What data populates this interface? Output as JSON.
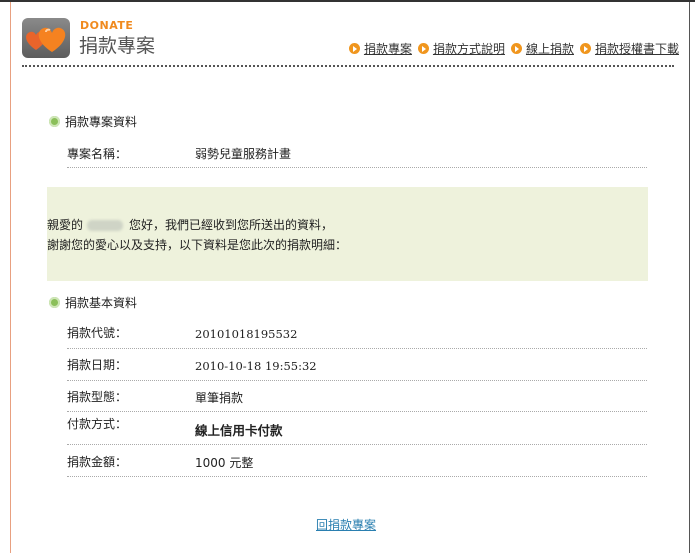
{
  "brand": {
    "en": "DONATE",
    "zh": "捐款專案"
  },
  "nav": [
    {
      "label": "捐款專案"
    },
    {
      "label": "捐款方式說明"
    },
    {
      "label": "線上捐款"
    },
    {
      "label": "捐款授權書下載"
    }
  ],
  "project_section": {
    "title": "捐款專案資料",
    "rows": [
      {
        "label": "專案名稱：",
        "value": "弱勢兒童服務計畫"
      }
    ]
  },
  "notice": {
    "prefix": "親愛的",
    "suffix": "您好，我們已經收到您所送出的資料，",
    "line2": "謝謝您的愛心以及支持，以下資料是您此次的捐款明細："
  },
  "basic_section": {
    "title": "捐款基本資料",
    "rows": [
      {
        "label": "捐款代號：",
        "value": "20101018195532"
      },
      {
        "label": "捐款日期：",
        "value": "2010-10-18 19:55:32"
      },
      {
        "label": "捐款型態：",
        "value": "單筆捐款"
      },
      {
        "label": "付款方式：",
        "value": "線上信用卡付款"
      },
      {
        "label": "捐款金額：",
        "value": "1000 元整"
      }
    ]
  },
  "back_link": "回捐款專案",
  "colors": {
    "accent": "#f0961e",
    "section_dot": "#8bbf5a",
    "notice_bg": "#eef2dc",
    "link": "#2a7fb0"
  }
}
